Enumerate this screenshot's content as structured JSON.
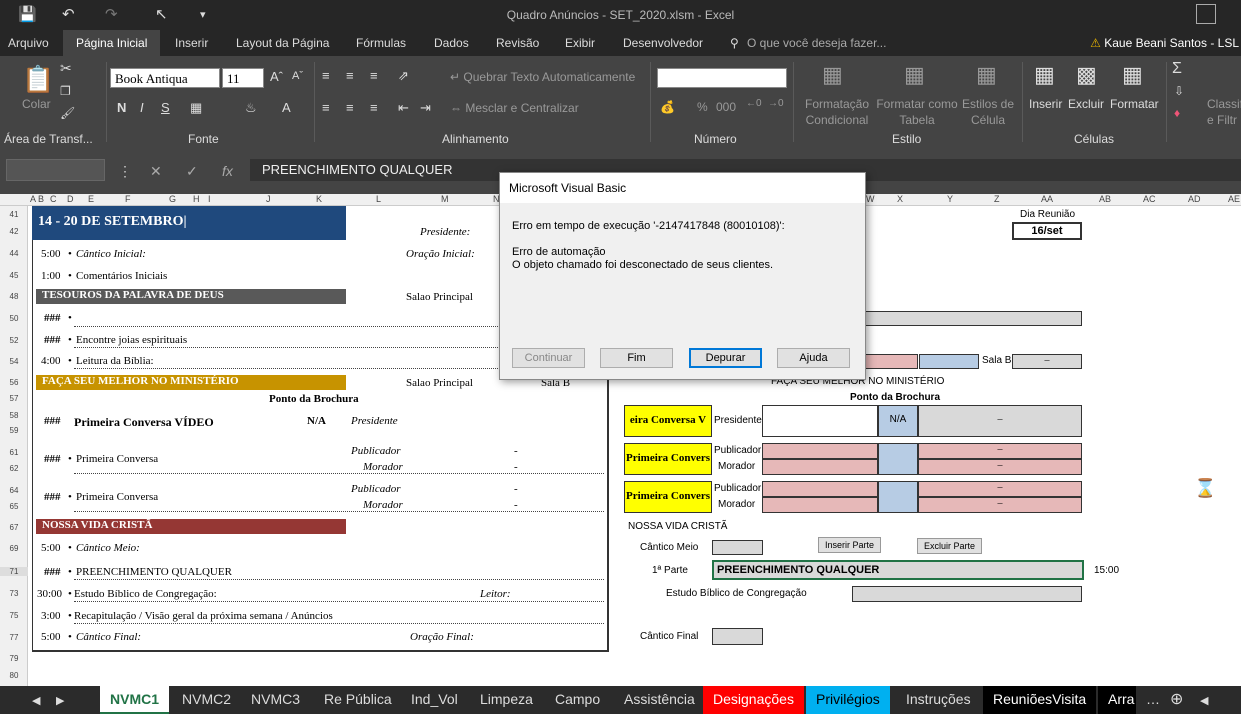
{
  "window": {
    "title": "Quadro Anúncios - SET_2020.xlsm - Excel",
    "user": "Kaue Beani Santos - LSL"
  },
  "ribbon_tabs": [
    "Arquivo",
    "Página Inicial",
    "Inserir",
    "Layout da Página",
    "Fórmulas",
    "Dados",
    "Revisão",
    "Exibir",
    "Desenvolvedor"
  ],
  "tell_me": "O que você deseja fazer...",
  "ribbon": {
    "paste": "Colar",
    "clipboard_group": "Área de Transf...",
    "font_name": "Book Antiqua",
    "font_size": "11",
    "font_group": "Fonte",
    "wrap_text": "Quebrar Texto Automaticamente",
    "merge_center": "Mesclar e Centralizar",
    "alignment_group": "Alinhamento",
    "number_group": "Número",
    "cond_format": "Formatação Condicional",
    "format_table": "Formatar como Tabela",
    "cell_styles": "Estilos de Célula",
    "styles_group": "Estilo",
    "insert": "Inserir",
    "delete": "Excluir",
    "format": "Formatar",
    "cells_group": "Células",
    "classify": "Classif e Filtr"
  },
  "formula_bar": {
    "content": "PREENCHIMENTO QUALQUER"
  },
  "columns": [
    "A",
    "B",
    "C",
    "D",
    "E",
    "F",
    "G",
    "H",
    "I",
    "J",
    "K",
    "L",
    "M",
    "N",
    "W",
    "X",
    "Y",
    "Z",
    "AA",
    "AB",
    "AC",
    "AD",
    "AE"
  ],
  "rows": [
    "41",
    "42",
    "44",
    "45",
    "48",
    "50",
    "52",
    "54",
    "56",
    "57",
    "58",
    "59",
    "61",
    "62",
    "64",
    "65",
    "67",
    "69",
    "71",
    "73",
    "75",
    "77",
    "79",
    "80"
  ],
  "sheet": {
    "week_title": "14 - 20 DE SETEMBRO|",
    "presidente": "Presidente:",
    "cantico_inicial_time": "5:00",
    "cantico_inicial": "Cântico Inicial:",
    "oracao_inicial": "Oração Inicial:",
    "comentarios_time": "1:00",
    "comentarios": "Comentários Iniciais",
    "tesouros": "TESOUROS DA PALAVRA DE DEUS",
    "salao_principal": "Salao Principal",
    "hash": "###",
    "joias": "Encontre joias espirituais",
    "leitura_time": "4:00",
    "leitura": "Leitura da Bíblia:",
    "faca": "FAÇA SEU MELHOR NO MINISTÉRIO",
    "sala_b": "Sala B",
    "ponto_brochura": "Ponto da Brochura",
    "primeira_video": "Primeira Conversa VÍDEO",
    "na": "N/A",
    "presidente2": "Presidente",
    "primeira_conversa": "Primeira Conversa",
    "publicador": "Publicador",
    "morador": "Morador",
    "dash": "-",
    "nossa_vida": "NOSSA VIDA CRISTÃ",
    "cantico_meio_time": "5:00",
    "cantico_meio": "Cântico Meio:",
    "preenchimento": "PREENCHIMENTO QUALQUER",
    "estudo_time": "30:00",
    "estudo": "Estudo Bíblico de Congregação:",
    "leitor": "Leitor:",
    "recap_time": "3:00",
    "recap": "Recapitulação / Visão geral da próxima semana / Anúncios",
    "cantico_final_time": "5:00",
    "cantico_final": "Cântico Final:",
    "oracao_final": "Oração Final:"
  },
  "panel": {
    "dia_reuniao": "Dia Reunião",
    "date": "16/set",
    "sala_b": "Sala B",
    "dash": "–",
    "faca": "FAÇA SEU MELHOR NO MINISTÉRIO",
    "ponto_brochura": "Ponto da Brochura",
    "yellow1": "eira Conversa V",
    "yellow2": "Primeira Convers",
    "yellow3": "Primeira Convers",
    "presidente": "Presidente",
    "na": "N/A",
    "publicador": "Publicador",
    "morador": "Morador",
    "nossa_vida": "NOSSA VIDA CRISTÃ",
    "cantico_meio": "Cântico Meio",
    "inserir_parte": "Inserir Parte",
    "excluir_parte": "Excluir Parte",
    "primeira_parte": "1ª Parte",
    "preenchimento": "PREENCHIMENTO QUALQUER",
    "time": "15:00",
    "estudo": "Estudo Bíblico de Congregação",
    "cantico_final": "Cântico Final"
  },
  "dialog": {
    "title": "Microsoft Visual Basic",
    "error_line": "Erro em tempo de execução '-2147417848 (80010108)':",
    "error_type": "Erro de automação",
    "error_desc": "O objeto chamado foi desconectado de seus clientes.",
    "btn_continue": "Continuar",
    "btn_end": "Fim",
    "btn_debug": "Depurar",
    "btn_help": "Ajuda"
  },
  "sheet_tabs": [
    "NVMC1",
    "NVMC2",
    "NVMC3",
    "Re Pública",
    "Ind_Vol",
    "Limpeza",
    "Campo",
    "Assistência",
    "Designações",
    "Privilégios",
    "Instruções",
    "ReuniõesVisita",
    "Arra"
  ],
  "colors": {
    "dark_blue_band": "#1f497d",
    "grey_band": "#595959",
    "gold_band": "#c79300",
    "red_band": "#953734",
    "designacoes_tab": "#ff0000",
    "privilegios_tab": "#00b0f0",
    "reunioes_tab": "#000000"
  }
}
